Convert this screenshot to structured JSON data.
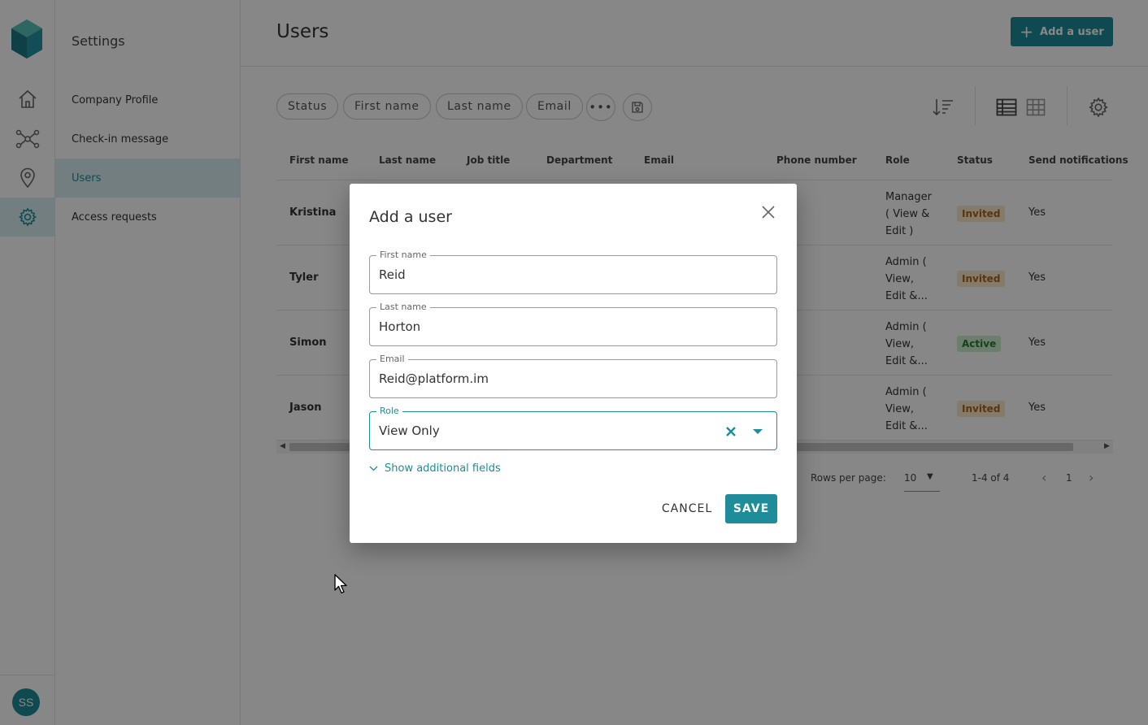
{
  "user": {
    "initials": "SS"
  },
  "settings": {
    "title": "Settings",
    "items": [
      {
        "label": "Company Profile"
      },
      {
        "label": "Check-in message"
      },
      {
        "label": "Users"
      },
      {
        "label": "Access requests"
      }
    ]
  },
  "header": {
    "title": "Users",
    "add_button": "Add a user"
  },
  "filters": [
    "Status",
    "First name",
    "Last name",
    "Email"
  ],
  "table": {
    "columns": [
      "First name",
      "Last name",
      "Job title",
      "Department",
      "Email",
      "Phone number",
      "Role",
      "Status",
      "Send notifications"
    ],
    "rows": [
      {
        "first_name": "Kristina",
        "role": "Manager ( View & Edit )",
        "status": "Invited",
        "notifications": "Yes"
      },
      {
        "first_name": "Tyler",
        "role": "Admin ( View, Edit &...",
        "status": "Invited",
        "notifications": "Yes"
      },
      {
        "first_name": "Simon",
        "role": "Admin ( View, Edit &...",
        "status": "Active",
        "notifications": "Yes"
      },
      {
        "first_name": "Jason",
        "role": "Admin ( View, Edit &...",
        "status": "Invited",
        "notifications": "Yes"
      }
    ]
  },
  "pagination": {
    "rows_per_page_label": "Rows per page:",
    "rows_per_page": "10",
    "range": "1-4 of 4",
    "page": "1"
  },
  "dialog": {
    "title": "Add a user",
    "fields": {
      "first_name": {
        "label": "First name",
        "value": "Reid"
      },
      "last_name": {
        "label": "Last name",
        "value": "Horton"
      },
      "email": {
        "label": "Email",
        "value": "Reid@platform.im"
      },
      "role": {
        "label": "Role",
        "value": "View Only"
      }
    },
    "more_fields": "Show additional fields",
    "cancel": "CANCEL",
    "save": "SAVE"
  },
  "colors": {
    "accent": "#1e8c99",
    "invited_bg": "#fde6c8",
    "active_bg": "#cdeecf"
  }
}
